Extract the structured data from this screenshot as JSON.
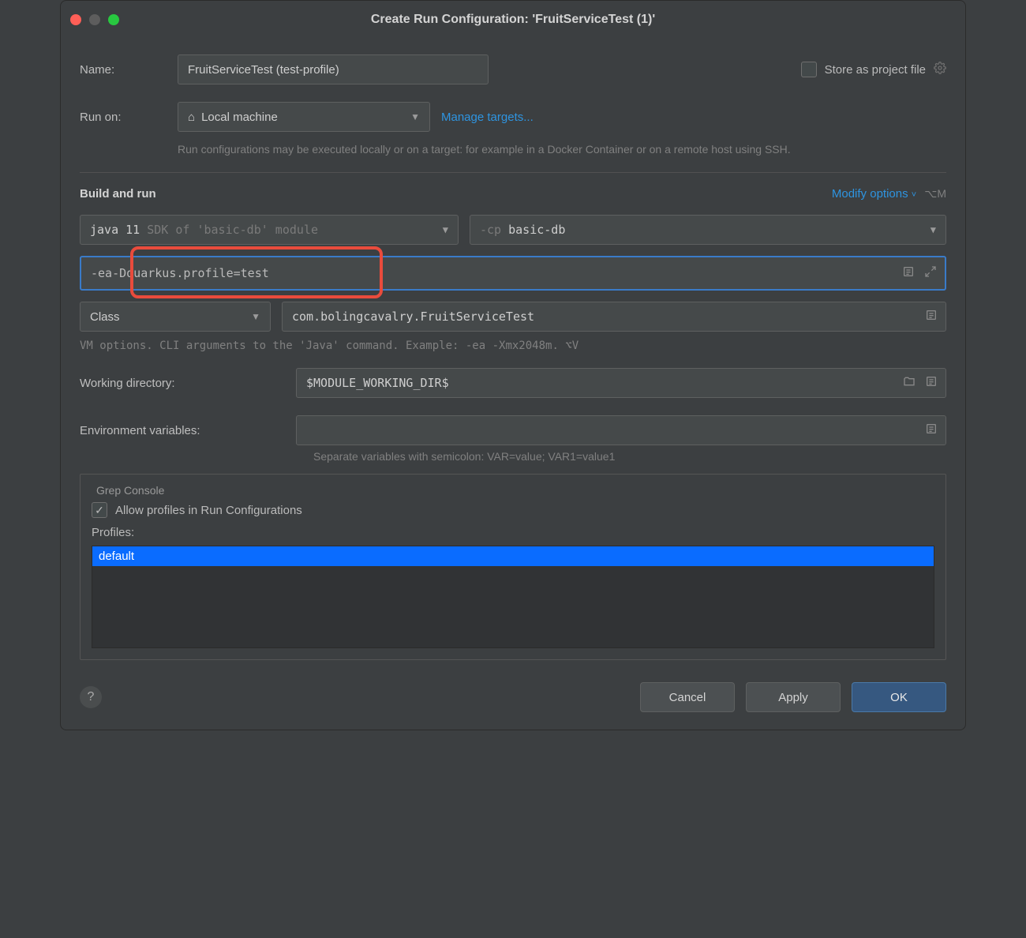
{
  "title": "Create Run Configuration: 'FruitServiceTest (1)'",
  "labels": {
    "name": "Name:",
    "run_on": "Run on:",
    "store_as_project": "Store as project file",
    "manage_targets": "Manage targets...",
    "run_on_hint": "Run configurations may be executed locally or on a target: for example in a Docker Container or on a remote host using SSH.",
    "build_and_run": "Build and run",
    "modify_options": "Modify options",
    "modify_shortcut": "⌥M",
    "vm_hint": "VM options. CLI arguments to the 'Java' command. Example: -ea -Xmx2048m. ⌥V",
    "working_dir": "Working directory:",
    "env_vars": "Environment variables:",
    "env_hint": "Separate variables with semicolon: VAR=value; VAR1=value1",
    "grep_console": "Grep Console",
    "allow_profiles": "Allow profiles in Run Configurations",
    "profiles": "Profiles:"
  },
  "fields": {
    "name": "FruitServiceTest (test-profile)",
    "run_on": "Local machine",
    "jdk_main": "java 11",
    "jdk_suffix": " SDK of 'basic-db' module",
    "classpath_prefix": "-cp ",
    "classpath": "basic-db",
    "vm_options_a": "-ea ",
    "vm_options_b": "-Dquarkus.profile=test",
    "run_type": "Class",
    "class_fqn": "com.bolingcavalry.FruitServiceTest",
    "working_dir": "$MODULE_WORKING_DIR$",
    "env": "",
    "profile_item": "default"
  },
  "buttons": {
    "cancel": "Cancel",
    "apply": "Apply",
    "ok": "OK"
  }
}
